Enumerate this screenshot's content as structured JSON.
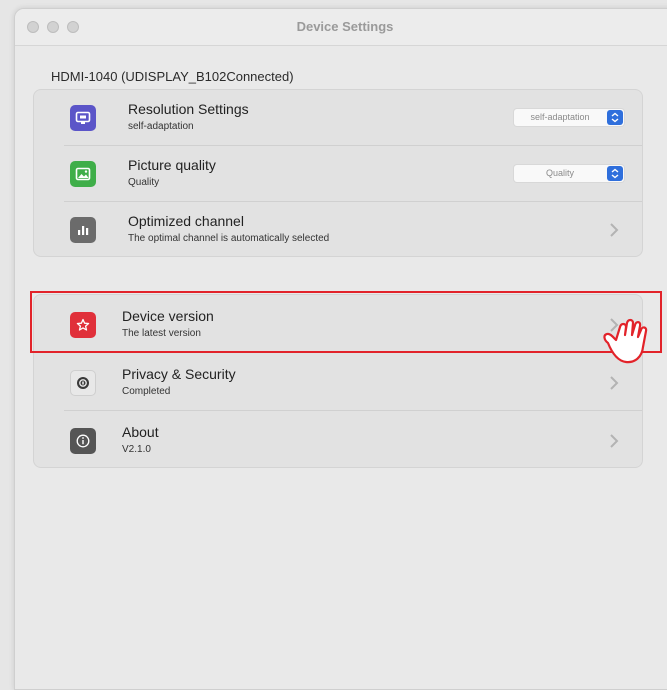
{
  "window": {
    "title": "Device Settings",
    "device_label": "HDMI-1040 (UDISPLAY_B102Connected)"
  },
  "display_group": [
    {
      "title": "Resolution Settings",
      "subtitle": "self-adaptation",
      "icon": "display-icon",
      "icon_color": "#5b55c8",
      "control": "select",
      "select_value": "self-adaptation"
    },
    {
      "title": "Picture quality",
      "subtitle": "Quality",
      "icon": "picture-icon",
      "icon_color": "#3fae49",
      "control": "select",
      "select_value": "Quality"
    },
    {
      "title": "Optimized channel",
      "subtitle": "The optimal channel is automatically selected",
      "icon": "bar-chart-icon",
      "icon_color": "#6b6b6b",
      "control": "chevron"
    }
  ],
  "system_group": [
    {
      "title": "Device version",
      "subtitle": "The latest version",
      "icon": "star-icon",
      "icon_color": "#e0303a",
      "control": "chevron"
    },
    {
      "title": "Privacy & Security",
      "subtitle": "Completed",
      "icon": "privacy-icon",
      "icon_color": "#e8e8e8",
      "control": "chevron"
    },
    {
      "title": "About",
      "subtitle": "V2.1.0",
      "icon": "info-icon",
      "icon_color": "#555555",
      "control": "chevron"
    }
  ],
  "annotation": {
    "highlight_color": "#e2232a",
    "pointer": "hand-pointer-icon"
  }
}
